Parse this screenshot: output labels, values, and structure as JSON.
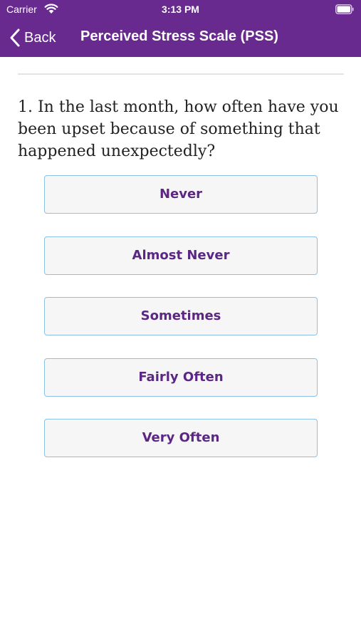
{
  "status_bar": {
    "carrier": "Carrier",
    "time": "3:13 PM"
  },
  "nav": {
    "back_label": "Back",
    "title": "Perceived Stress Scale (PSS)"
  },
  "question": {
    "text": "1. In the last month, how often have you been upset because of something that happened unexpectedly?"
  },
  "answers": [
    {
      "label": "Never"
    },
    {
      "label": "Almost Never"
    },
    {
      "label": "Sometimes"
    },
    {
      "label": "Fairly Often"
    },
    {
      "label": "Very Often"
    }
  ],
  "colors": {
    "header_background": "#682a8e",
    "answer_text": "#5b2684",
    "answer_border": "#8ec0e4",
    "answer_background": "#f6f6f7"
  },
  "icons": {
    "wifi": "wifi-icon",
    "battery": "battery-icon",
    "back": "chevron-left-icon"
  }
}
